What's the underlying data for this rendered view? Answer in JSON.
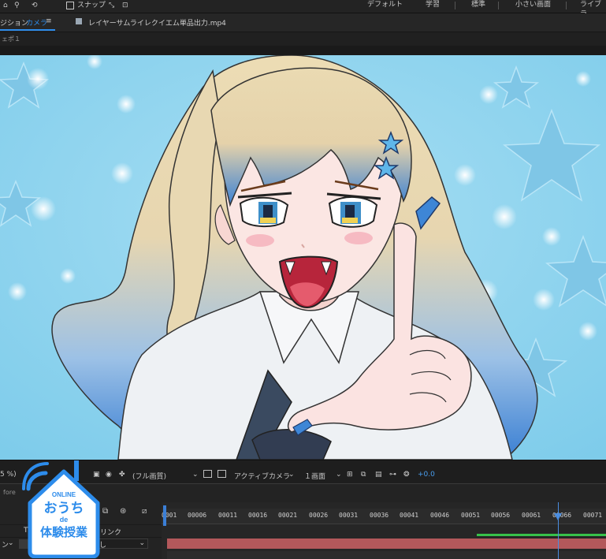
{
  "toolbar": {
    "snap_label": "スナップ",
    "workspaces": [
      "デフォルト",
      "学習",
      "標準",
      "小さい画面",
      "ライブラ"
    ]
  },
  "comp_panel": {
    "tab_label": "ジション",
    "camera_label": "カメラ",
    "menu_icon": "≡",
    "file_name": "レイヤーサムライレクイエム単品出力.mp4",
    "sub_label": "ェポ１"
  },
  "viewer_controls": {
    "zoom": "5 %)",
    "resolution": "(フル画質)",
    "camera": "アクティブカメラ",
    "views": "１画面",
    "exposure": "+0.0"
  },
  "timeline": {
    "header_label": "fore",
    "ticks": [
      "0001",
      "00006",
      "00011",
      "00016",
      "00021",
      "00026",
      "00031",
      "00036",
      "00041",
      "00046",
      "00051",
      "00056",
      "00061",
      "00066",
      "00071"
    ],
    "layer_label": "ヒリンク",
    "parent_value": "なし",
    "row_prefix": "ン"
  },
  "badge": {
    "line1": "ONLINE",
    "line2": "おうち",
    "line3": "de",
    "line4": "体験授業"
  },
  "colors": {
    "accent": "#2d8ceb",
    "sky": "#8fd3ee",
    "track": "#b3585b",
    "track_green": "#37c24a"
  }
}
